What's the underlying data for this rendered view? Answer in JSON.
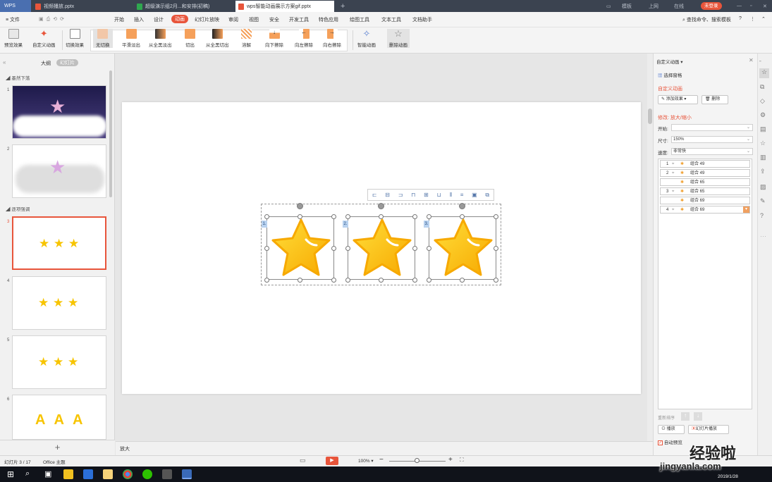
{
  "tabs": {
    "app": "WPS",
    "tab1": "视频播放.pptx",
    "tab2": "超级演示组2月...和安排(初稿)",
    "tab3": "wps智能动画展示方案gif.pptx"
  },
  "titlebar": {
    "item1": "模板",
    "item2": "上网",
    "item3": "在线",
    "login": "未登录"
  },
  "menu": {
    "file": "文件",
    "start": "开始",
    "insert": "插入",
    "design": "设计",
    "animation": "动画",
    "slideshow": "幻灯片放映",
    "review": "审阅",
    "view": "视图",
    "security": "安全",
    "devtools": "开发工具",
    "special": "特色应用",
    "draw": "绘图工具",
    "text": "文本工具",
    "docassist": "文档助手",
    "search": "查找命令、搜索模板"
  },
  "ribbon": {
    "preview": "预览效果",
    "custom": "自定义动画",
    "switch": "切换效果",
    "none": "无切换",
    "smooth": "平滑淡出",
    "fadeall": "从全黑淡出",
    "cut": "切出",
    "cutall": "从全黑切出",
    "dissolve": "溶解",
    "down": "向下擦除",
    "left": "向左擦除",
    "right": "向右擦除",
    "smart": "智能动画",
    "delete": "删除动画"
  },
  "leftpanel": {
    "outline": "大纲",
    "slides": "幻灯片",
    "section1": "墨然下落",
    "section2": "逐项强调",
    "nums": [
      "1",
      "2",
      "3",
      "4",
      "5",
      "6"
    ],
    "star": "★",
    "letters": "A A A"
  },
  "canvas": {
    "tags": [
      "1.",
      "2.",
      "3."
    ]
  },
  "rightpanel": {
    "title": "自定义动画",
    "select_pane": "选择窗格",
    "custom_title": "自定义动画",
    "add_effect": "添加效果",
    "delete": "删除",
    "modify": "修改: 放大/缩小",
    "start_label": "开始:",
    "start_value": "",
    "size_label": "尺寸:",
    "size_value": "150%",
    "speed_label": "速度:",
    "speed_value": "非常快",
    "rows": [
      {
        "num": "1",
        "name": "组合 49"
      },
      {
        "num": "2",
        "name": "组合 49"
      },
      {
        "num": "",
        "name": "组合 65"
      },
      {
        "num": "3",
        "name": "组合 65"
      },
      {
        "num": "",
        "name": "组合 69"
      },
      {
        "num": "4",
        "name": "组合 69"
      }
    ],
    "reorder": "重新排序",
    "play": "播放",
    "slideshow": "幻灯片播放",
    "autopreview": "自动预览"
  },
  "statusbar": {
    "slide": "幻灯片 3 / 17",
    "theme": "Office 主题",
    "note": "放大",
    "zoom": "100%"
  },
  "taskbar": {
    "date": "2019/1/28"
  },
  "watermark": {
    "top": "经验啦",
    "url": "jingyanla.com"
  },
  "colors": {
    "accent": "#e8553b",
    "star": "#f7c400"
  }
}
